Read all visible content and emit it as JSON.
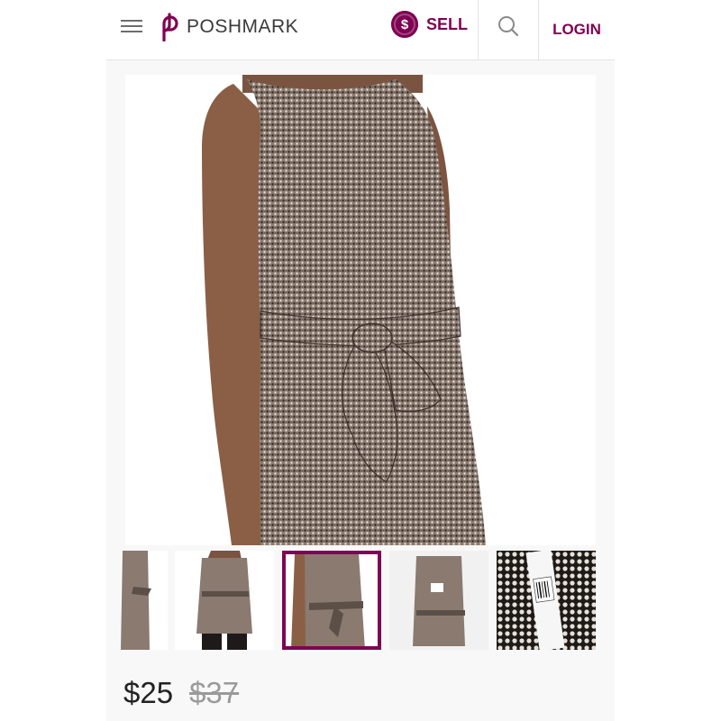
{
  "header": {
    "brand": "POSHMARK",
    "sell_symbol": "$",
    "sell_label": "SELL",
    "login_label": "LOGIN"
  },
  "listing": {
    "price": "$25",
    "original_price": "$37",
    "thumbnail_count": 5,
    "selected_thumbnail": 3
  },
  "colors": {
    "brand": "#7f0353",
    "text": "#222222",
    "muted": "#9a9a9a"
  },
  "icons": {
    "menu": "hamburger-icon",
    "logo": "poshmark-logo-icon",
    "search": "search-icon"
  }
}
